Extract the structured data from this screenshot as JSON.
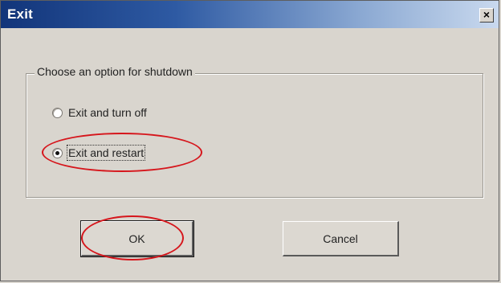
{
  "window": {
    "title": "Exit",
    "close_glyph": "×"
  },
  "group": {
    "legend": "Choose an option for shutdown"
  },
  "options": [
    {
      "label": "Exit and turn off",
      "selected": false
    },
    {
      "label": "Exit and restart",
      "selected": true
    }
  ],
  "buttons": {
    "ok_label": "OK",
    "cancel_label": "Cancel"
  },
  "icons": {
    "close": "close-icon",
    "radio": "radio-button-icon"
  },
  "colors": {
    "title_gradient_start": "#12357a",
    "title_gradient_end": "#c9d9ee",
    "dialog_background": "#d9d5ce",
    "highlight_annotation": "#d6161c"
  }
}
